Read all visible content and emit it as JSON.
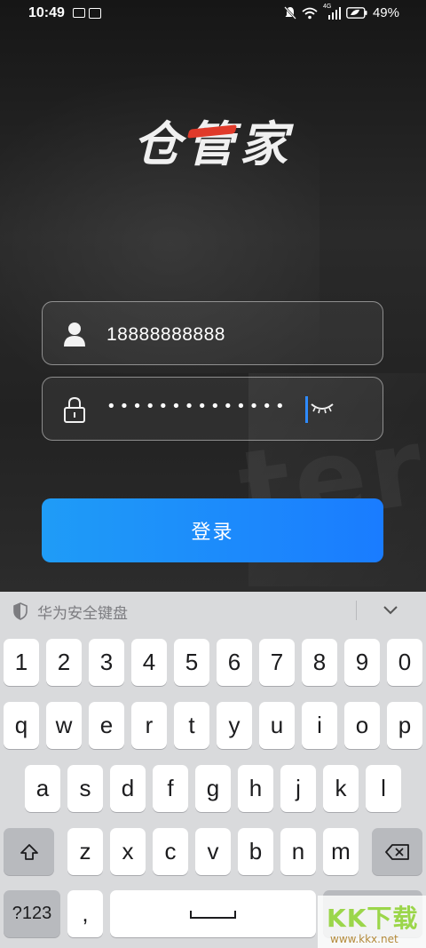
{
  "status_bar": {
    "time": "10:49",
    "battery": "49%",
    "network_label": "4G"
  },
  "app": {
    "logo_text": "仓管家",
    "background_text": "ter",
    "username": {
      "value": "18888888888"
    },
    "password": {
      "masked_value": "••••••••••••••"
    },
    "login_button_label": "登录",
    "accent_color": "#1a7cff"
  },
  "keyboard": {
    "title": "华为安全键盘",
    "rows": {
      "numbers": [
        "1",
        "2",
        "3",
        "4",
        "5",
        "6",
        "7",
        "8",
        "9",
        "0"
      ],
      "row1": [
        "q",
        "w",
        "e",
        "r",
        "t",
        "y",
        "u",
        "i",
        "o",
        "p"
      ],
      "row2": [
        "a",
        "s",
        "d",
        "f",
        "g",
        "h",
        "j",
        "k",
        "l"
      ],
      "row3": [
        "z",
        "x",
        "c",
        "v",
        "b",
        "n",
        "m"
      ]
    },
    "symbols_label": "?123",
    "comma_label": ","
  },
  "watermark": {
    "text": "KK下载",
    "url": "www.kkx.net"
  }
}
